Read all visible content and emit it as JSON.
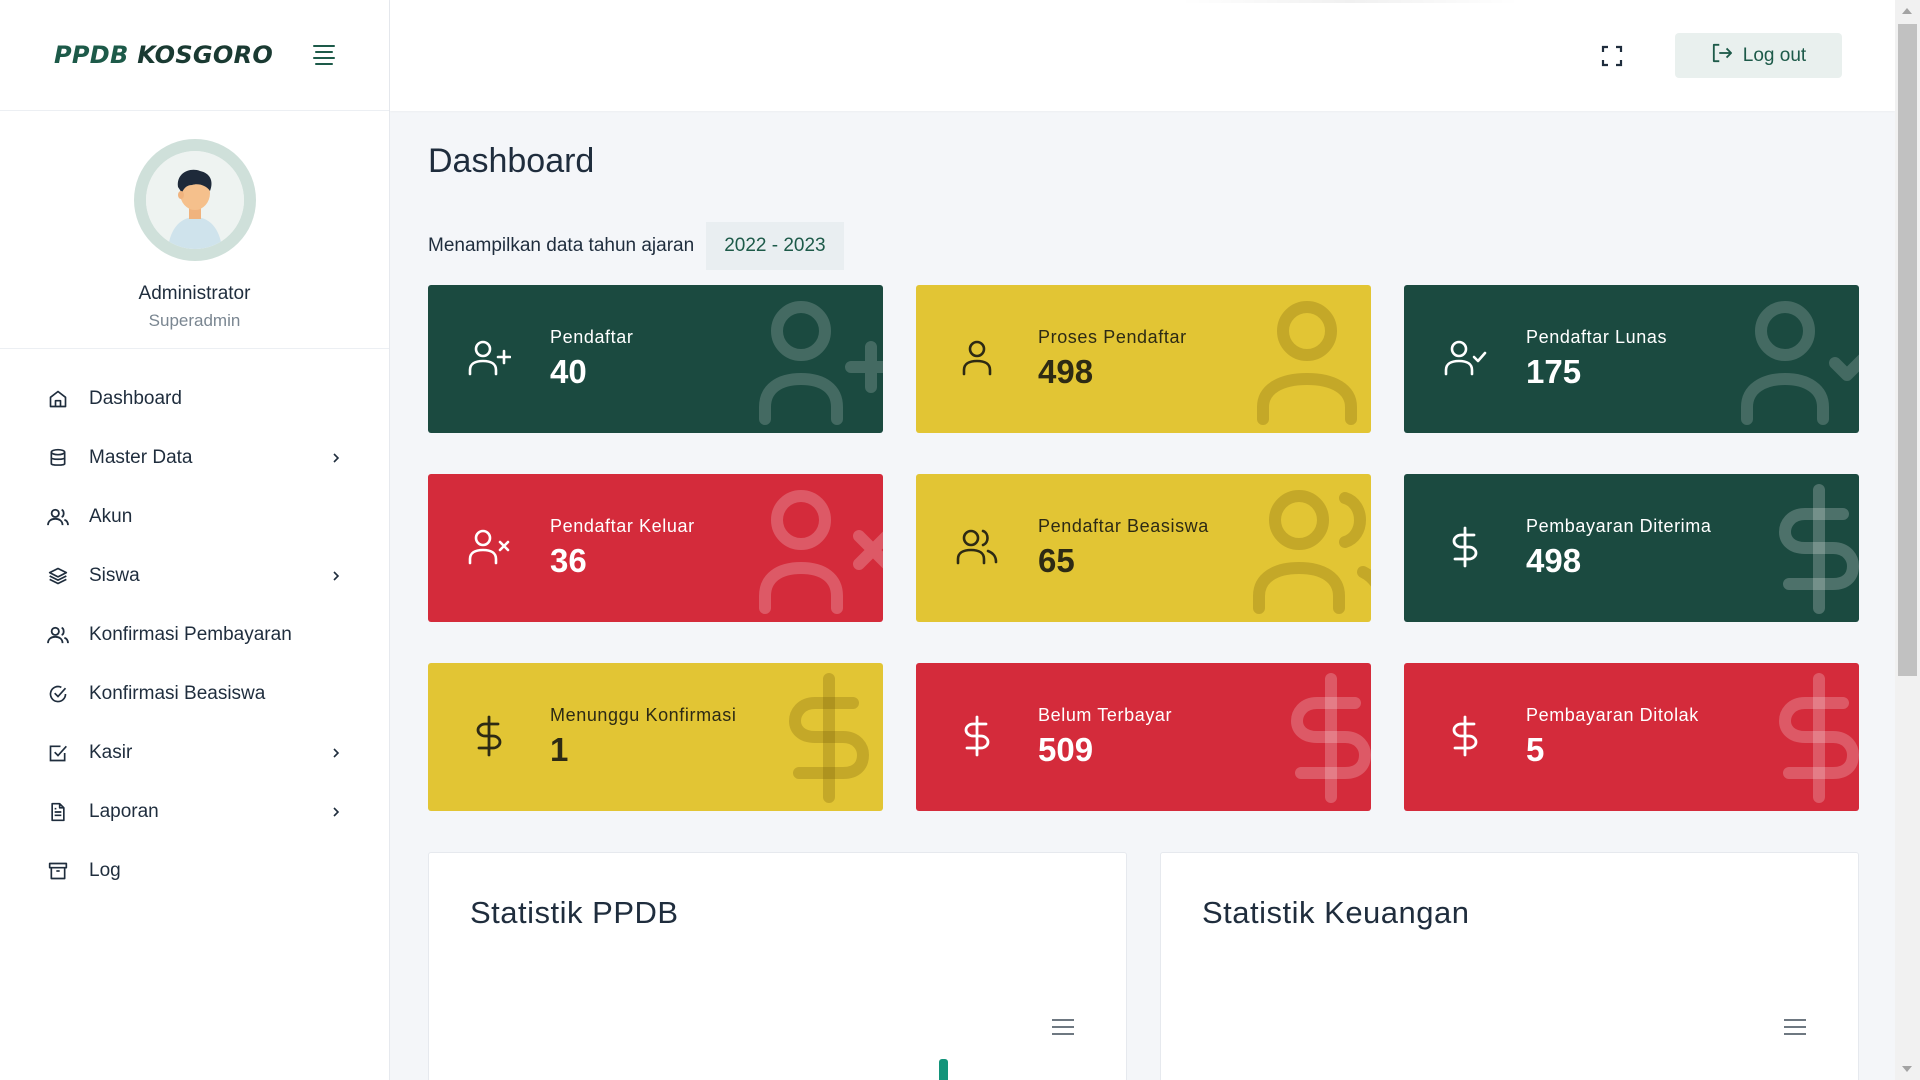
{
  "brand": {
    "part1": "PPDB",
    "part2": "KOSGORO"
  },
  "profile": {
    "name": "Administrator",
    "role": "Superadmin"
  },
  "menu": [
    {
      "label": "Dashboard",
      "icon": "home-icon",
      "has_children": false
    },
    {
      "label": "Master Data",
      "icon": "database-icon",
      "has_children": true
    },
    {
      "label": "Akun",
      "icon": "users-icon",
      "has_children": false
    },
    {
      "label": "Siswa",
      "icon": "layers-icon",
      "has_children": true
    },
    {
      "label": "Konfirmasi Pembayaran",
      "icon": "users-icon",
      "has_children": false
    },
    {
      "label": "Konfirmasi Beasiswa",
      "icon": "check-circle-icon",
      "has_children": false
    },
    {
      "label": "Kasir",
      "icon": "check-square-icon",
      "has_children": true
    },
    {
      "label": "Laporan",
      "icon": "file-text-icon",
      "has_children": true
    },
    {
      "label": "Log",
      "icon": "archive-icon",
      "has_children": false
    }
  ],
  "header": {
    "logout_label": "Log out"
  },
  "page": {
    "title": "Dashboard",
    "year_label": "Menampilkan data tahun ajaran",
    "year_value": "2022 - 2023"
  },
  "cards": [
    {
      "title": "Pendaftar",
      "value": "40",
      "color": "#1b4a40",
      "icon": "user-plus-icon"
    },
    {
      "title": "Proses Pendaftar",
      "value": "498",
      "color": "#e2c534",
      "icon": "user-icon"
    },
    {
      "title": "Pendaftar Lunas",
      "value": "175",
      "color": "#1b4a40",
      "icon": "user-check-icon"
    },
    {
      "title": "Pendaftar Keluar",
      "value": "36",
      "color": "#d42b3b",
      "icon": "user-x-icon"
    },
    {
      "title": "Pendaftar Beasiswa",
      "value": "65",
      "color": "#e2c534",
      "icon": "users-icon"
    },
    {
      "title": "Pembayaran Diterima",
      "value": "498",
      "color": "#1b4a40",
      "icon": "dollar-icon"
    },
    {
      "title": "Menunggu Konfirmasi",
      "value": "1",
      "color": "#e2c534",
      "icon": "dollar-icon"
    },
    {
      "title": "Belum Terbayar",
      "value": "509",
      "color": "#d42b3b",
      "icon": "dollar-icon"
    },
    {
      "title": "Pembayaran Ditolak",
      "value": "5",
      "color": "#d42b3b",
      "icon": "dollar-icon"
    }
  ],
  "panels": [
    {
      "title": "Statistik PPDB"
    },
    {
      "title": "Statistik Keuangan"
    }
  ],
  "colors": {
    "accent": "#1d5a49",
    "green": "#1b4a40",
    "yellow": "#e2c534",
    "red": "#d42b3b",
    "chart_bar": "#13947a"
  }
}
